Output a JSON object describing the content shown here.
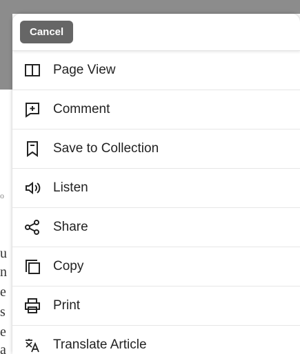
{
  "background": {
    "letters": [
      "o",
      "u",
      "n",
      "e",
      "s",
      "e",
      "a"
    ]
  },
  "sheet": {
    "cancel_label": "Cancel",
    "items": [
      {
        "label": "Page View",
        "icon": "page-view-icon"
      },
      {
        "label": "Comment",
        "icon": "comment-icon"
      },
      {
        "label": "Save to Collection",
        "icon": "bookmark-icon"
      },
      {
        "label": "Listen",
        "icon": "speaker-icon"
      },
      {
        "label": "Share",
        "icon": "share-icon"
      },
      {
        "label": "Copy",
        "icon": "copy-icon"
      },
      {
        "label": "Print",
        "icon": "print-icon"
      },
      {
        "label": "Translate Article",
        "icon": "translate-icon"
      }
    ]
  },
  "colors": {
    "cancel_bg": "#666666",
    "text": "#222222",
    "divider": "#e6e6e6"
  }
}
